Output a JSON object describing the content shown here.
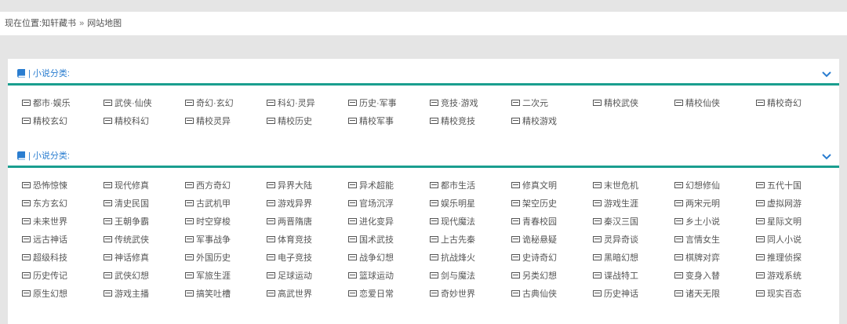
{
  "breadcrumb": {
    "prefix": "现在位置:",
    "home": "知轩藏书",
    "separator": "»",
    "current": "网站地图"
  },
  "sections": [
    {
      "title": "| 小说分类:",
      "icon": "book-icon",
      "items": [
        "都市·娱乐",
        "武侠·仙侠",
        "奇幻·玄幻",
        "科幻·灵异",
        "历史·军事",
        "竞技·游戏",
        "二次元",
        "精校武侠",
        "精校仙侠",
        "精校奇幻",
        "精校玄幻",
        "精校科幻",
        "精校灵异",
        "精校历史",
        "精校军事",
        "精校竞技",
        "精校游戏"
      ]
    },
    {
      "title": "| 小说分类:",
      "icon": "book-icon",
      "items": [
        "恐怖惊悚",
        "现代修真",
        "西方奇幻",
        "异界大陆",
        "异术超能",
        "都市生活",
        "修真文明",
        "末世危机",
        "幻想修仙",
        "五代十国",
        "东方玄幻",
        "清史民国",
        "古武机甲",
        "游戏异界",
        "官场沉浮",
        "娱乐明星",
        "架空历史",
        "游戏生涯",
        "两宋元明",
        "虚拟网游",
        "未来世界",
        "王朝争霸",
        "时空穿梭",
        "两晋隋唐",
        "进化变异",
        "现代魔法",
        "青春校园",
        "秦汉三国",
        "乡土小说",
        "星际文明",
        "远古神话",
        "传统武侠",
        "军事战争",
        "体育竞技",
        "国术武技",
        "上古先秦",
        "诡秘悬疑",
        "灵异奇谈",
        "言情女生",
        "同人小说",
        "超级科技",
        "神话修真",
        "外国历史",
        "电子竞技",
        "战争幻想",
        "抗战烽火",
        "史诗奇幻",
        "黑暗幻想",
        "棋牌对弈",
        "推理侦探",
        "历史传记",
        "武侠幻想",
        "军旅生涯",
        "足球运动",
        "篮球运动",
        "剑与魔法",
        "另类幻想",
        "谍战特工",
        "变身入替",
        "游戏系统",
        "原生幻想",
        "游戏主播",
        "搞笑吐槽",
        "高武世界",
        "恋爱日常",
        "奇妙世界",
        "古典仙侠",
        "历史神话",
        "诸天无限",
        "现实百态"
      ]
    }
  ],
  "colors": {
    "accent": "#1a9e8f",
    "title": "#2a7dd0"
  }
}
